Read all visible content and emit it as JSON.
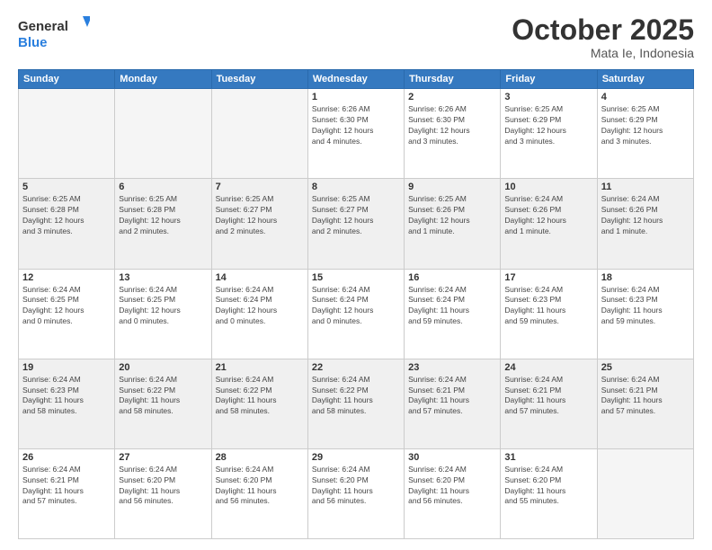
{
  "logo": {
    "general": "General",
    "blue": "Blue"
  },
  "header": {
    "month": "October 2025",
    "location": "Mata Ie, Indonesia"
  },
  "weekdays": [
    "Sunday",
    "Monday",
    "Tuesday",
    "Wednesday",
    "Thursday",
    "Friday",
    "Saturday"
  ],
  "weeks": [
    [
      {
        "day": "",
        "info": ""
      },
      {
        "day": "",
        "info": ""
      },
      {
        "day": "",
        "info": ""
      },
      {
        "day": "1",
        "info": "Sunrise: 6:26 AM\nSunset: 6:30 PM\nDaylight: 12 hours\nand 4 minutes."
      },
      {
        "day": "2",
        "info": "Sunrise: 6:26 AM\nSunset: 6:30 PM\nDaylight: 12 hours\nand 3 minutes."
      },
      {
        "day": "3",
        "info": "Sunrise: 6:25 AM\nSunset: 6:29 PM\nDaylight: 12 hours\nand 3 minutes."
      },
      {
        "day": "4",
        "info": "Sunrise: 6:25 AM\nSunset: 6:29 PM\nDaylight: 12 hours\nand 3 minutes."
      }
    ],
    [
      {
        "day": "5",
        "info": "Sunrise: 6:25 AM\nSunset: 6:28 PM\nDaylight: 12 hours\nand 3 minutes."
      },
      {
        "day": "6",
        "info": "Sunrise: 6:25 AM\nSunset: 6:28 PM\nDaylight: 12 hours\nand 2 minutes."
      },
      {
        "day": "7",
        "info": "Sunrise: 6:25 AM\nSunset: 6:27 PM\nDaylight: 12 hours\nand 2 minutes."
      },
      {
        "day": "8",
        "info": "Sunrise: 6:25 AM\nSunset: 6:27 PM\nDaylight: 12 hours\nand 2 minutes."
      },
      {
        "day": "9",
        "info": "Sunrise: 6:25 AM\nSunset: 6:26 PM\nDaylight: 12 hours\nand 1 minute."
      },
      {
        "day": "10",
        "info": "Sunrise: 6:24 AM\nSunset: 6:26 PM\nDaylight: 12 hours\nand 1 minute."
      },
      {
        "day": "11",
        "info": "Sunrise: 6:24 AM\nSunset: 6:26 PM\nDaylight: 12 hours\nand 1 minute."
      }
    ],
    [
      {
        "day": "12",
        "info": "Sunrise: 6:24 AM\nSunset: 6:25 PM\nDaylight: 12 hours\nand 0 minutes."
      },
      {
        "day": "13",
        "info": "Sunrise: 6:24 AM\nSunset: 6:25 PM\nDaylight: 12 hours\nand 0 minutes."
      },
      {
        "day": "14",
        "info": "Sunrise: 6:24 AM\nSunset: 6:24 PM\nDaylight: 12 hours\nand 0 minutes."
      },
      {
        "day": "15",
        "info": "Sunrise: 6:24 AM\nSunset: 6:24 PM\nDaylight: 12 hours\nand 0 minutes."
      },
      {
        "day": "16",
        "info": "Sunrise: 6:24 AM\nSunset: 6:24 PM\nDaylight: 11 hours\nand 59 minutes."
      },
      {
        "day": "17",
        "info": "Sunrise: 6:24 AM\nSunset: 6:23 PM\nDaylight: 11 hours\nand 59 minutes."
      },
      {
        "day": "18",
        "info": "Sunrise: 6:24 AM\nSunset: 6:23 PM\nDaylight: 11 hours\nand 59 minutes."
      }
    ],
    [
      {
        "day": "19",
        "info": "Sunrise: 6:24 AM\nSunset: 6:23 PM\nDaylight: 11 hours\nand 58 minutes."
      },
      {
        "day": "20",
        "info": "Sunrise: 6:24 AM\nSunset: 6:22 PM\nDaylight: 11 hours\nand 58 minutes."
      },
      {
        "day": "21",
        "info": "Sunrise: 6:24 AM\nSunset: 6:22 PM\nDaylight: 11 hours\nand 58 minutes."
      },
      {
        "day": "22",
        "info": "Sunrise: 6:24 AM\nSunset: 6:22 PM\nDaylight: 11 hours\nand 58 minutes."
      },
      {
        "day": "23",
        "info": "Sunrise: 6:24 AM\nSunset: 6:21 PM\nDaylight: 11 hours\nand 57 minutes."
      },
      {
        "day": "24",
        "info": "Sunrise: 6:24 AM\nSunset: 6:21 PM\nDaylight: 11 hours\nand 57 minutes."
      },
      {
        "day": "25",
        "info": "Sunrise: 6:24 AM\nSunset: 6:21 PM\nDaylight: 11 hours\nand 57 minutes."
      }
    ],
    [
      {
        "day": "26",
        "info": "Sunrise: 6:24 AM\nSunset: 6:21 PM\nDaylight: 11 hours\nand 57 minutes."
      },
      {
        "day": "27",
        "info": "Sunrise: 6:24 AM\nSunset: 6:20 PM\nDaylight: 11 hours\nand 56 minutes."
      },
      {
        "day": "28",
        "info": "Sunrise: 6:24 AM\nSunset: 6:20 PM\nDaylight: 11 hours\nand 56 minutes."
      },
      {
        "day": "29",
        "info": "Sunrise: 6:24 AM\nSunset: 6:20 PM\nDaylight: 11 hours\nand 56 minutes."
      },
      {
        "day": "30",
        "info": "Sunrise: 6:24 AM\nSunset: 6:20 PM\nDaylight: 11 hours\nand 56 minutes."
      },
      {
        "day": "31",
        "info": "Sunrise: 6:24 AM\nSunset: 6:20 PM\nDaylight: 11 hours\nand 55 minutes."
      },
      {
        "day": "",
        "info": ""
      }
    ]
  ]
}
